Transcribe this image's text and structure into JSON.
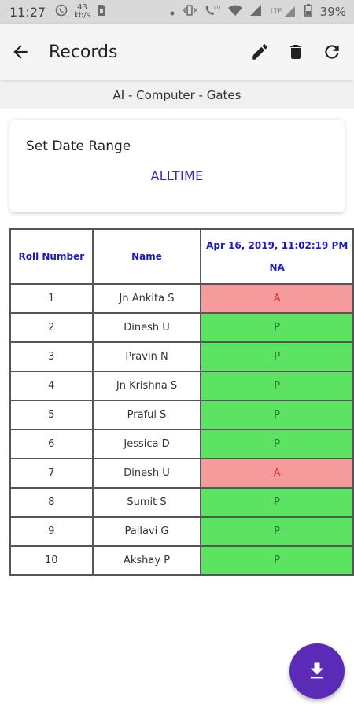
{
  "status_bar": {
    "time": "11:27",
    "data_speed_top": "43",
    "data_speed_bottom": "kb/s",
    "lte_label": "LTE",
    "battery": "39%"
  },
  "app_bar": {
    "title": "Records"
  },
  "subtitle": "AI - Computer - Gates",
  "date_range": {
    "label": "Set Date Range",
    "value": "ALLTIME"
  },
  "table": {
    "headers": {
      "roll": "Roll Number",
      "name": "Name",
      "date": "Apr 16, 2019, 11:02:19 PM",
      "date_sub": "NA"
    },
    "rows": [
      {
        "roll": "1",
        "name": "Jn Ankita S",
        "status": "A"
      },
      {
        "roll": "2",
        "name": "Dinesh U",
        "status": "P"
      },
      {
        "roll": "3",
        "name": "Pravin N",
        "status": "P"
      },
      {
        "roll": "4",
        "name": "Jn Krishna S",
        "status": "P"
      },
      {
        "roll": "5",
        "name": "Praful S",
        "status": "P"
      },
      {
        "roll": "6",
        "name": "Jessica D",
        "status": "P"
      },
      {
        "roll": "7",
        "name": "Dinesh U",
        "status": "A"
      },
      {
        "roll": "8",
        "name": "Sumit S",
        "status": "P"
      },
      {
        "roll": "9",
        "name": "Pallavi G",
        "status": "P"
      },
      {
        "roll": "10",
        "name": "Akshay P",
        "status": "P"
      }
    ]
  },
  "colors": {
    "absent": "#f59b9b",
    "present": "#5de362",
    "accent": "#5b2ab6",
    "header_text": "#1a1acc"
  },
  "icons": {
    "back": "arrow-left-icon",
    "edit": "pencil-icon",
    "delete": "trash-icon",
    "refresh": "refresh-icon",
    "download": "download-icon"
  }
}
